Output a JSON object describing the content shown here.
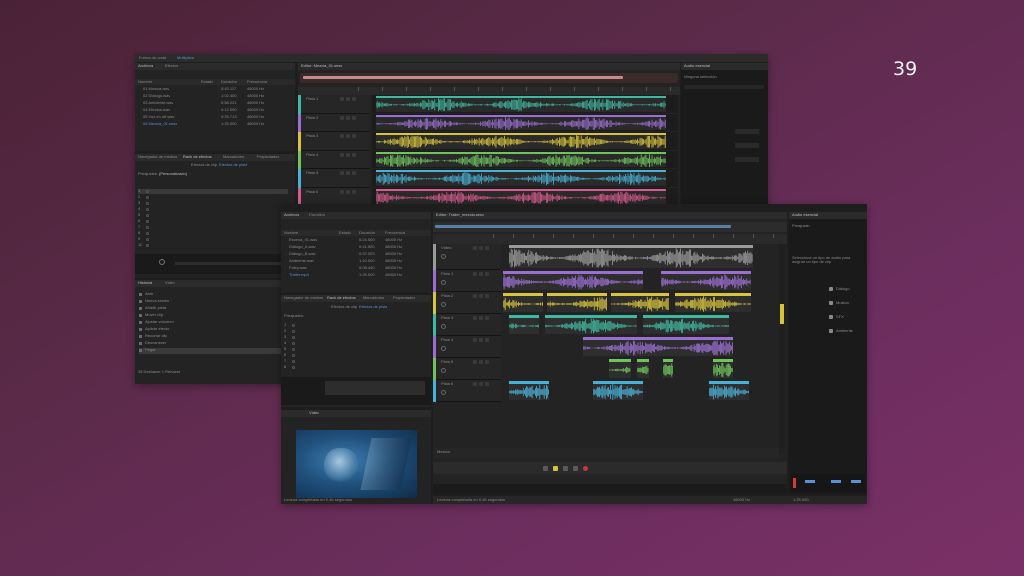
{
  "slide": {
    "number": "39"
  },
  "colors": {
    "bg_top": "#4a2236",
    "bg_bottom": "#7a3066",
    "panel": "#232323",
    "accent_blue": "#5b8fd6",
    "track_teal": "#3fb8a0",
    "track_purple": "#9b6fd1",
    "track_yellow": "#d8c43a",
    "track_green": "#6fc45c",
    "track_pink": "#d85a8e",
    "track_cyan": "#49b0d6",
    "track_gray": "#9a9a9a",
    "track_orange": "#e0a83a"
  },
  "back_window": {
    "menu": [
      "Forma de onda",
      "Multipista"
    ],
    "files_panel": {
      "tabs": [
        "Archivos",
        "Efectos"
      ],
      "columns": [
        "Nombre",
        "Estado",
        "Duración",
        "Frecuencia"
      ],
      "rows": [
        [
          "01 Música.wav",
          "0:43.117",
          "48000 Hz"
        ],
        [
          "02 Diálogo.wav",
          "1:02.400",
          "48000 Hz"
        ],
        [
          "03 Ambiente.wav",
          "0:58.221",
          "48000 Hz"
        ],
        [
          "04 Efectos.wav",
          "0:12.090",
          "48000 Hz"
        ],
        [
          "05 Voz en off.wav",
          "0:33.713",
          "48000 Hz"
        ],
        [
          "06 Mezcla_01.sesx",
          "1:25.000",
          "48000 Hz"
        ]
      ]
    },
    "effects_panel": {
      "tabs": [
        "Navegador de medios",
        "Rack de efectos",
        "Marcadores",
        "Propiedades"
      ],
      "subtabs": [
        "Efectos de clip",
        "Efectos de pista"
      ],
      "preset_label": "Preajustes:",
      "preset_value": "(Personalizado)",
      "slots": [
        "1",
        "2",
        "3",
        "4",
        "5",
        "6",
        "7",
        "8",
        "9",
        "10"
      ]
    },
    "history_panel": {
      "tabs": [
        "Historial",
        "Vídeo"
      ],
      "items": [
        "Abrir",
        "Nueva sesión",
        "Añadir pista",
        "Mover clip",
        "Ajustar volumen",
        "Aplicar efecto",
        "Recortar clip",
        "Desvanecer",
        "Pegar"
      ],
      "footer": "38 Deshacer 1 Rehacer"
    },
    "editor": {
      "tab": "Editor: Mezcla_01.sesx",
      "tracks": [
        {
          "name": "Pista 1",
          "color": "#3fb8a0"
        },
        {
          "name": "Pista 2",
          "color": "#9b6fd1"
        },
        {
          "name": "Pista 3",
          "color": "#d8c43a"
        },
        {
          "name": "Pista 4",
          "color": "#6fc45c"
        },
        {
          "name": "Pista 5",
          "color": "#49b0d6"
        },
        {
          "name": "Pista 6",
          "color": "#d85a8e"
        },
        {
          "name": "Pista 7",
          "color": "#6fc45c"
        },
        {
          "name": "Pista 8",
          "color": "#3fb8a0"
        }
      ]
    },
    "right_panel": {
      "tabs": [
        "Audio esencial"
      ],
      "title": "Ninguna selección"
    }
  },
  "front_window": {
    "files_panel": {
      "tabs": [
        "Archivos",
        "Favoritos"
      ],
      "columns": [
        "Nombre",
        "Estado",
        "Duración",
        "Frecuencia"
      ],
      "rows": [
        [
          "Escena_01.wav",
          "0:24.500",
          "48000 Hz"
        ],
        [
          "Diálogo_A.wav",
          "0:41.920",
          "48000 Hz"
        ],
        [
          "Diálogo_B.wav",
          "0:37.003",
          "48000 Hz"
        ],
        [
          "Ambiente.wav",
          "1:10.000",
          "48000 Hz"
        ],
        [
          "Foley.wav",
          "0:08.440",
          "48000 Hz"
        ],
        [
          "Trailer.mp4",
          "1:25.000",
          "48000 Hz"
        ]
      ]
    },
    "effects_panel": {
      "tabs": [
        "Navegador de medios",
        "Rack de efectos",
        "Marcadores",
        "Propiedades"
      ],
      "subtabs": [
        "Efectos de clip",
        "Efectos de pista"
      ],
      "preset_label": "Preajustes:",
      "slots": [
        "1",
        "2",
        "3",
        "4",
        "5",
        "6",
        "7",
        "8"
      ]
    },
    "video": {
      "tab": "Vídeo",
      "status": "Lectura completada en 0,46 segundos"
    },
    "editor": {
      "tab": "Editor: Trailer_mezcla.sesx",
      "tracks": [
        {
          "name": "Vídeo",
          "color": "#9a9a9a"
        },
        {
          "name": "Pista 1",
          "color": "#9b6fd1"
        },
        {
          "name": "Pista 2",
          "color": "#d8c43a"
        },
        {
          "name": "Pista 3",
          "color": "#3fb8a0"
        },
        {
          "name": "Pista 4",
          "color": "#9b6fd1"
        },
        {
          "name": "Pista 5",
          "color": "#6fc45c"
        },
        {
          "name": "Pista 6",
          "color": "#49b0d6"
        }
      ],
      "mix_label": "Mezcla"
    },
    "essential_sound": {
      "tab": "Audio esencial",
      "subtitle": "Preajuste:",
      "options": [
        "Diálogo",
        "Música",
        "SFX",
        "Ambiente"
      ],
      "hint": "Seleccione un tipo de audio para asignar un tipo de clip"
    },
    "status_bar": {
      "left": "Lectura completada en 0,46 segundos",
      "middle": "48000 Hz",
      "right": "1:25.000"
    }
  }
}
